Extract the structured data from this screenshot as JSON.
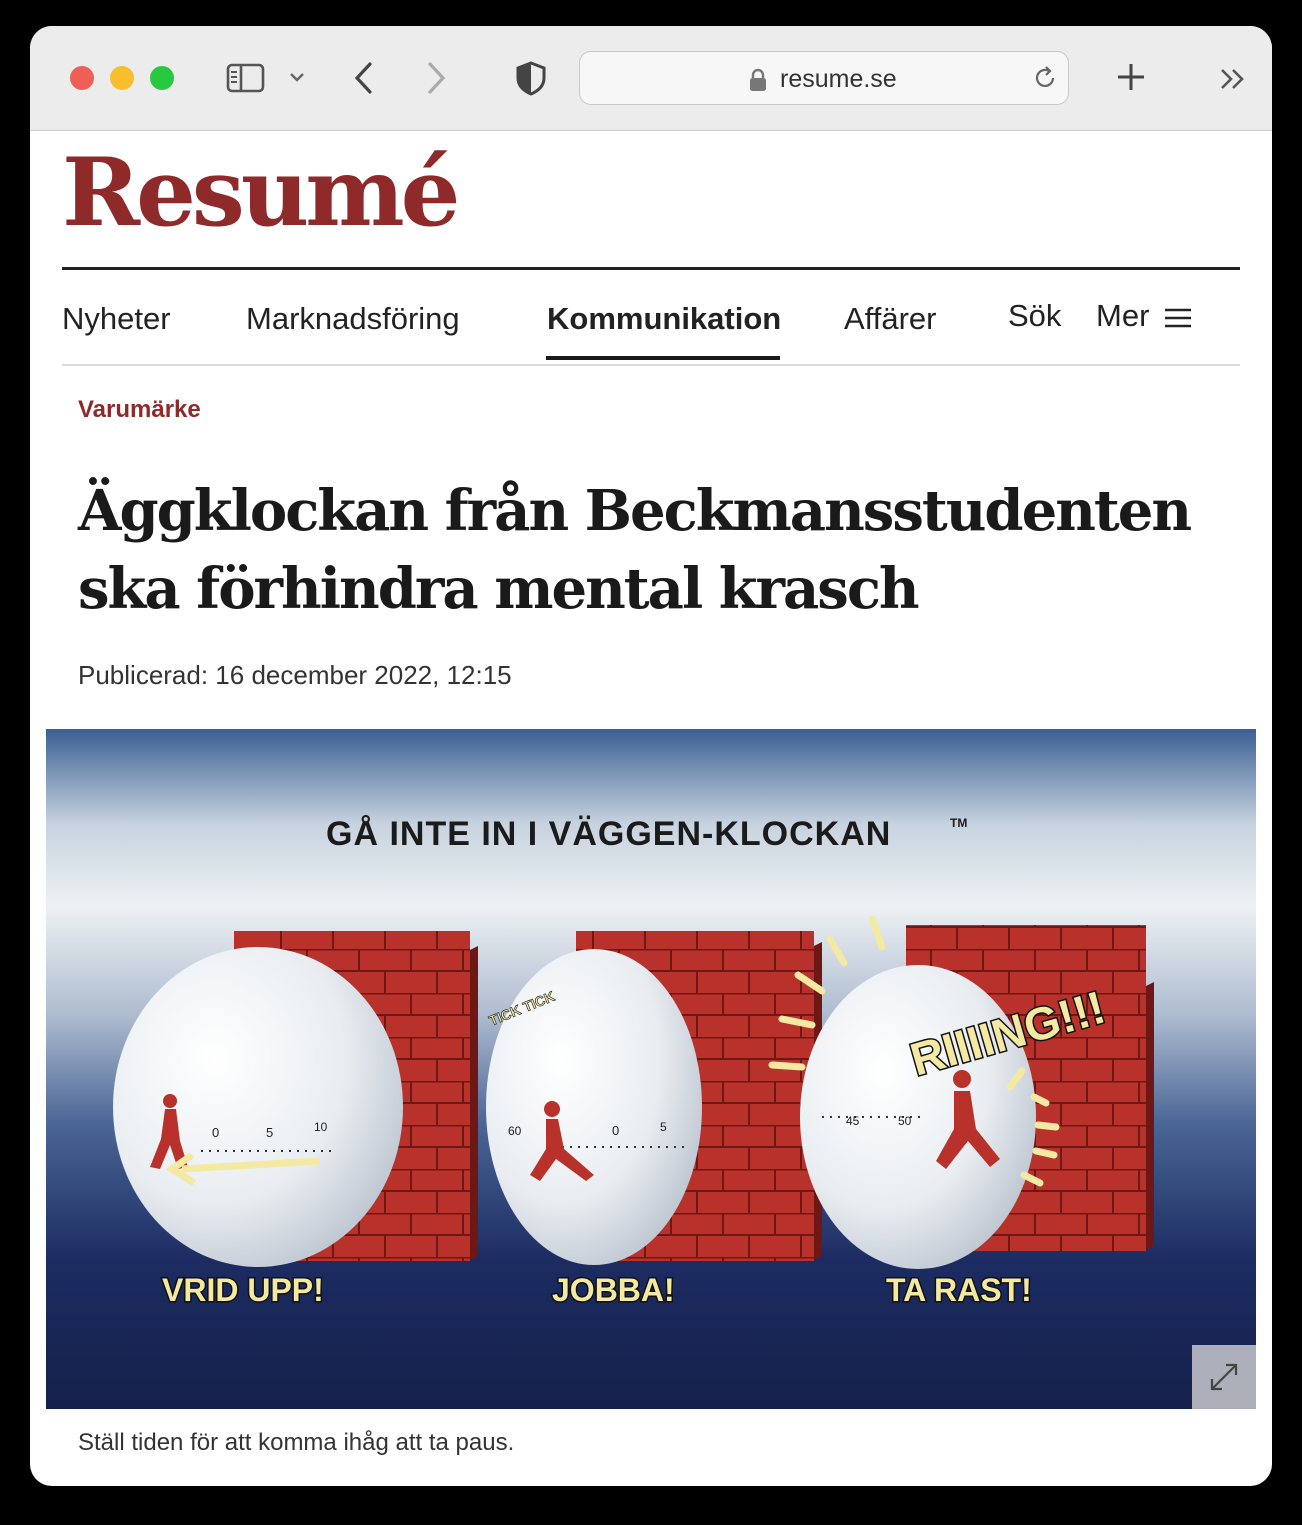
{
  "browser": {
    "url": "resume.se"
  },
  "site": {
    "logo": "Resumé"
  },
  "nav": {
    "items": [
      "Nyheter",
      "Marknadsföring",
      "Kommunikation",
      "Affärer",
      "Sök"
    ],
    "more_label": "Mer",
    "active": "Kommunikation"
  },
  "article": {
    "category": "Varumärke",
    "title_line1": "Äggklockan från Beckmansstudenten",
    "title_line2": "ska förhindra mental krasch",
    "published": "Publicerad: 16 december 2022, 12:15",
    "image": {
      "headline": "GÅ INTE IN I VÄGGEN-KLOCKAN",
      "trademark": "TM",
      "label_1": "VRID UPP!",
      "label_2": "JOBBA!",
      "label_3": "TA RAST!",
      "tick_text": "TICK TICK",
      "ring_text": "RIIIING!!!",
      "dial_1": [
        "0",
        "5",
        "10"
      ],
      "dial_2": [
        "60",
        "0",
        "5"
      ],
      "dial_3": [
        "45",
        "50"
      ]
    },
    "caption": "Ställ tiden för att komma ihåg att ta paus."
  },
  "colors": {
    "brand": "#8f2a2a",
    "brick": "#b8322b",
    "label_yellow": "#f3e9a2"
  }
}
